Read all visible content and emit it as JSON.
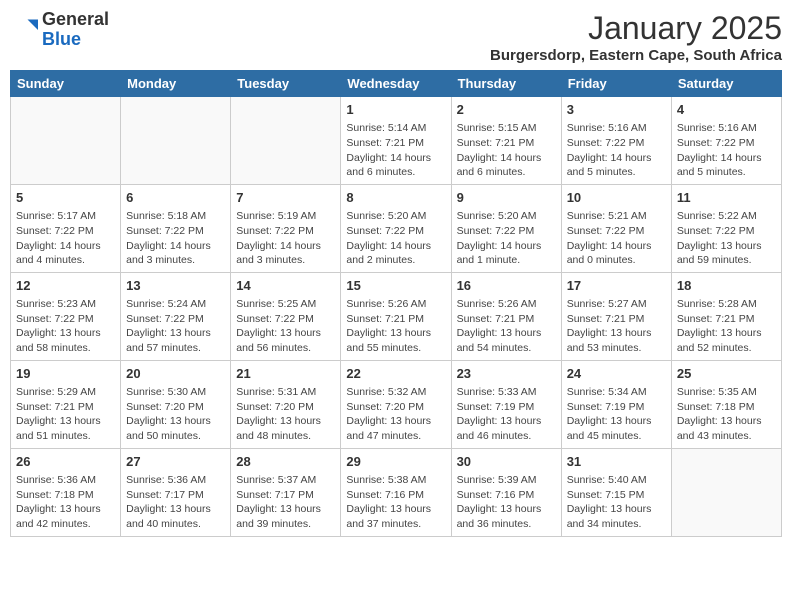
{
  "header": {
    "logo": {
      "general": "General",
      "blue": "Blue"
    },
    "title": "January 2025",
    "subtitle": "Burgersdorp, Eastern Cape, South Africa"
  },
  "days_of_week": [
    "Sunday",
    "Monday",
    "Tuesday",
    "Wednesday",
    "Thursday",
    "Friday",
    "Saturday"
  ],
  "weeks": [
    [
      {
        "day": "",
        "info": ""
      },
      {
        "day": "",
        "info": ""
      },
      {
        "day": "",
        "info": ""
      },
      {
        "day": "1",
        "info": "Sunrise: 5:14 AM\nSunset: 7:21 PM\nDaylight: 14 hours and 6 minutes."
      },
      {
        "day": "2",
        "info": "Sunrise: 5:15 AM\nSunset: 7:21 PM\nDaylight: 14 hours and 6 minutes."
      },
      {
        "day": "3",
        "info": "Sunrise: 5:16 AM\nSunset: 7:22 PM\nDaylight: 14 hours and 5 minutes."
      },
      {
        "day": "4",
        "info": "Sunrise: 5:16 AM\nSunset: 7:22 PM\nDaylight: 14 hours and 5 minutes."
      }
    ],
    [
      {
        "day": "5",
        "info": "Sunrise: 5:17 AM\nSunset: 7:22 PM\nDaylight: 14 hours and 4 minutes."
      },
      {
        "day": "6",
        "info": "Sunrise: 5:18 AM\nSunset: 7:22 PM\nDaylight: 14 hours and 3 minutes."
      },
      {
        "day": "7",
        "info": "Sunrise: 5:19 AM\nSunset: 7:22 PM\nDaylight: 14 hours and 3 minutes."
      },
      {
        "day": "8",
        "info": "Sunrise: 5:20 AM\nSunset: 7:22 PM\nDaylight: 14 hours and 2 minutes."
      },
      {
        "day": "9",
        "info": "Sunrise: 5:20 AM\nSunset: 7:22 PM\nDaylight: 14 hours and 1 minute."
      },
      {
        "day": "10",
        "info": "Sunrise: 5:21 AM\nSunset: 7:22 PM\nDaylight: 14 hours and 0 minutes."
      },
      {
        "day": "11",
        "info": "Sunrise: 5:22 AM\nSunset: 7:22 PM\nDaylight: 13 hours and 59 minutes."
      }
    ],
    [
      {
        "day": "12",
        "info": "Sunrise: 5:23 AM\nSunset: 7:22 PM\nDaylight: 13 hours and 58 minutes."
      },
      {
        "day": "13",
        "info": "Sunrise: 5:24 AM\nSunset: 7:22 PM\nDaylight: 13 hours and 57 minutes."
      },
      {
        "day": "14",
        "info": "Sunrise: 5:25 AM\nSunset: 7:22 PM\nDaylight: 13 hours and 56 minutes."
      },
      {
        "day": "15",
        "info": "Sunrise: 5:26 AM\nSunset: 7:21 PM\nDaylight: 13 hours and 55 minutes."
      },
      {
        "day": "16",
        "info": "Sunrise: 5:26 AM\nSunset: 7:21 PM\nDaylight: 13 hours and 54 minutes."
      },
      {
        "day": "17",
        "info": "Sunrise: 5:27 AM\nSunset: 7:21 PM\nDaylight: 13 hours and 53 minutes."
      },
      {
        "day": "18",
        "info": "Sunrise: 5:28 AM\nSunset: 7:21 PM\nDaylight: 13 hours and 52 minutes."
      }
    ],
    [
      {
        "day": "19",
        "info": "Sunrise: 5:29 AM\nSunset: 7:21 PM\nDaylight: 13 hours and 51 minutes."
      },
      {
        "day": "20",
        "info": "Sunrise: 5:30 AM\nSunset: 7:20 PM\nDaylight: 13 hours and 50 minutes."
      },
      {
        "day": "21",
        "info": "Sunrise: 5:31 AM\nSunset: 7:20 PM\nDaylight: 13 hours and 48 minutes."
      },
      {
        "day": "22",
        "info": "Sunrise: 5:32 AM\nSunset: 7:20 PM\nDaylight: 13 hours and 47 minutes."
      },
      {
        "day": "23",
        "info": "Sunrise: 5:33 AM\nSunset: 7:19 PM\nDaylight: 13 hours and 46 minutes."
      },
      {
        "day": "24",
        "info": "Sunrise: 5:34 AM\nSunset: 7:19 PM\nDaylight: 13 hours and 45 minutes."
      },
      {
        "day": "25",
        "info": "Sunrise: 5:35 AM\nSunset: 7:18 PM\nDaylight: 13 hours and 43 minutes."
      }
    ],
    [
      {
        "day": "26",
        "info": "Sunrise: 5:36 AM\nSunset: 7:18 PM\nDaylight: 13 hours and 42 minutes."
      },
      {
        "day": "27",
        "info": "Sunrise: 5:36 AM\nSunset: 7:17 PM\nDaylight: 13 hours and 40 minutes."
      },
      {
        "day": "28",
        "info": "Sunrise: 5:37 AM\nSunset: 7:17 PM\nDaylight: 13 hours and 39 minutes."
      },
      {
        "day": "29",
        "info": "Sunrise: 5:38 AM\nSunset: 7:16 PM\nDaylight: 13 hours and 37 minutes."
      },
      {
        "day": "30",
        "info": "Sunrise: 5:39 AM\nSunset: 7:16 PM\nDaylight: 13 hours and 36 minutes."
      },
      {
        "day": "31",
        "info": "Sunrise: 5:40 AM\nSunset: 7:15 PM\nDaylight: 13 hours and 34 minutes."
      },
      {
        "day": "",
        "info": ""
      }
    ]
  ]
}
